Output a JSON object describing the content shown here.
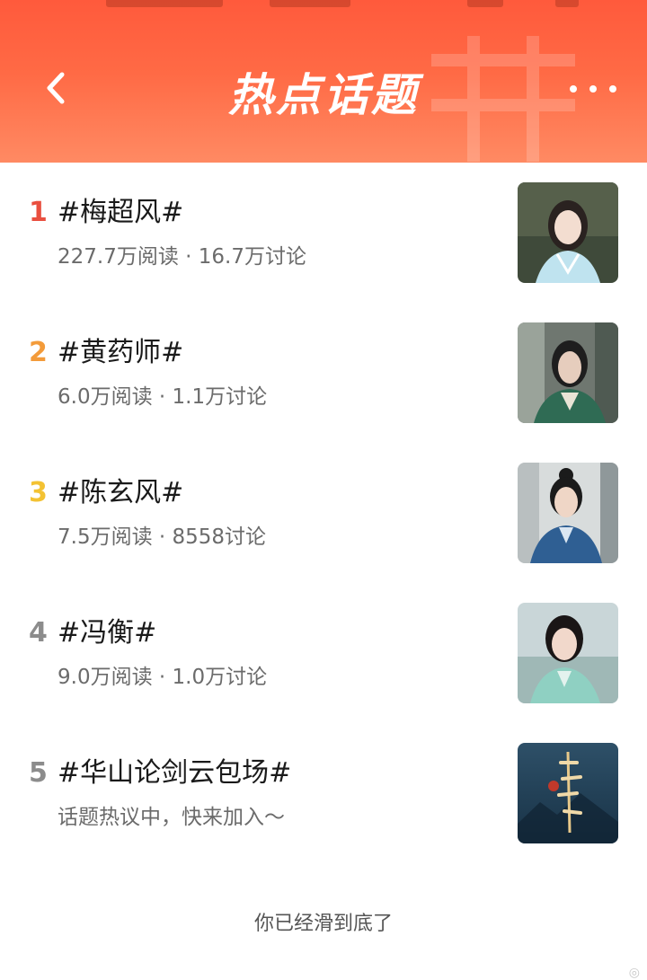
{
  "header": {
    "title": "热点话题",
    "back_icon": "chevron-left-icon",
    "more_icon": "more-horizontal-icon",
    "gradient_top": "#ff5a3c",
    "gradient_bottom": "#ff8a63"
  },
  "rank_colors": {
    "1": "#e94f3f",
    "2": "#f39b3a",
    "3": "#f3c233",
    "4": "#8c8c8c",
    "5": "#8c8c8c"
  },
  "topics": [
    {
      "rank": "1",
      "title": "#梅超风#",
      "stats": "227.7万阅读 · 16.7万讨论",
      "thumb": "woman-light-blue"
    },
    {
      "rank": "2",
      "title": "#黄药师#",
      "stats": "6.0万阅读 · 1.1万讨论",
      "thumb": "man-green-robe"
    },
    {
      "rank": "3",
      "title": "#陈玄风#",
      "stats": "7.5万阅读 · 8558讨论",
      "thumb": "man-blue-robe"
    },
    {
      "rank": "4",
      "title": "#冯衡#",
      "stats": "9.0万阅读 · 1.0万讨论",
      "thumb": "woman-mint-dress"
    },
    {
      "rank": "5",
      "title": "#华山论剑云包场#",
      "stats": "话题热议中，快来加入～",
      "thumb": "huashan-poster"
    }
  ],
  "footer": {
    "end_text": "你已经滑到底了"
  }
}
